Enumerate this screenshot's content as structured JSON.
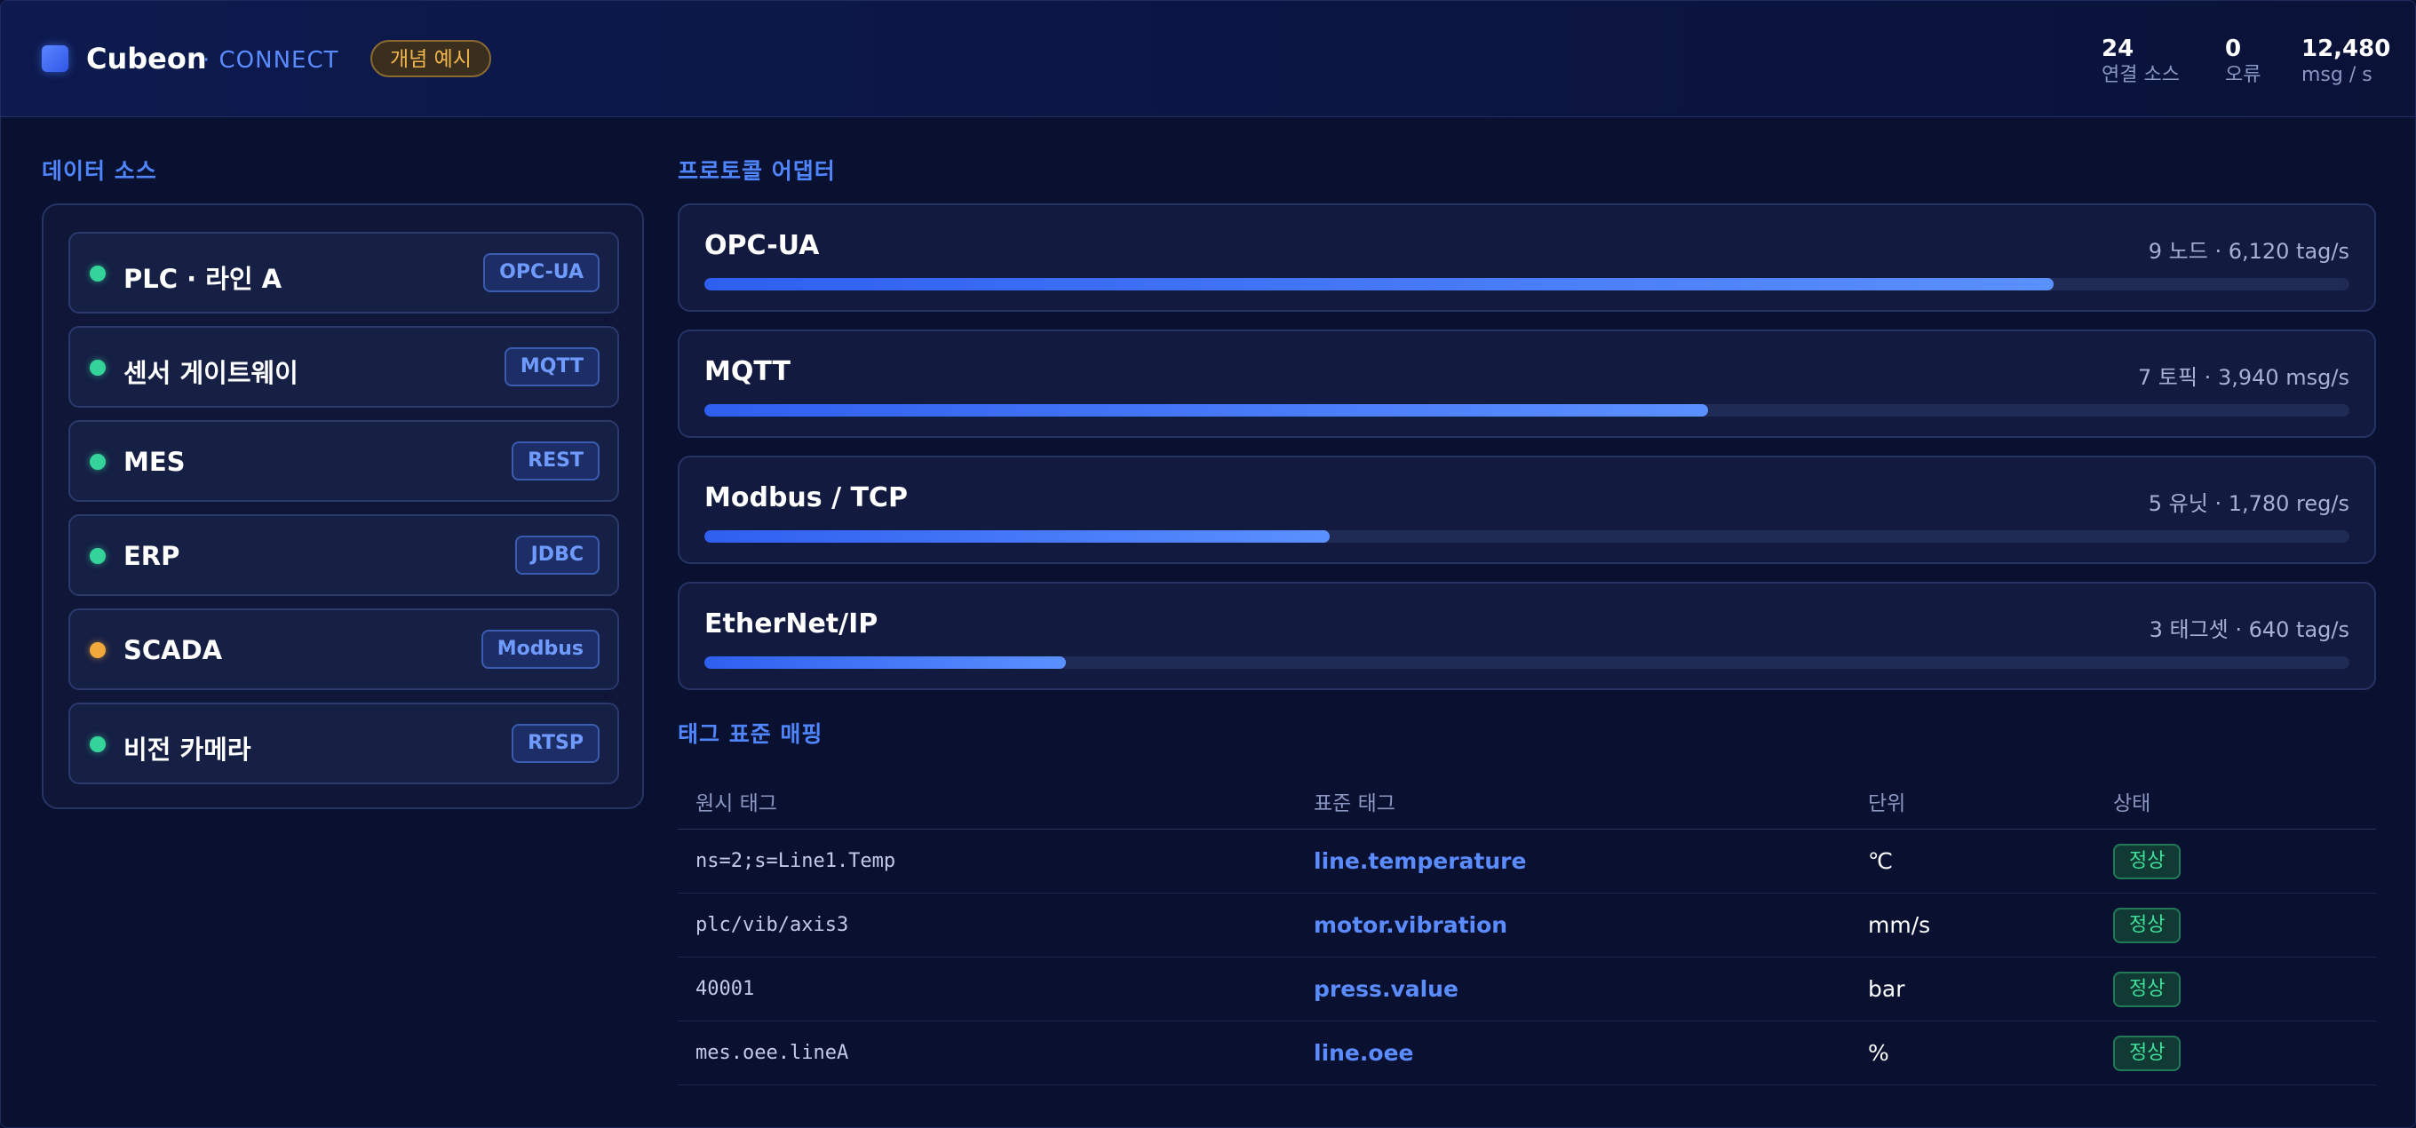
{
  "header": {
    "brand": "Cubeon",
    "brand_sub": "· CONNECT",
    "badge": "개념 예시",
    "stats": [
      {
        "value": "24",
        "label": "연결 소스"
      },
      {
        "value": "0",
        "label": "오류"
      },
      {
        "value": "12,480",
        "label": "msg / s"
      }
    ]
  },
  "sources": {
    "title": "데이터 소스",
    "items": [
      {
        "name": "PLC · 라인 A",
        "protocol": "OPC-UA",
        "status": "green"
      },
      {
        "name": "센서 게이트웨이",
        "protocol": "MQTT",
        "status": "green"
      },
      {
        "name": "MES",
        "protocol": "REST",
        "status": "green"
      },
      {
        "name": "ERP",
        "protocol": "JDBC",
        "status": "green"
      },
      {
        "name": "SCADA",
        "protocol": "Modbus",
        "status": "amber"
      },
      {
        "name": "비전 카메라",
        "protocol": "RTSP",
        "status": "green"
      }
    ]
  },
  "adapters": {
    "title": "프로토콜 어댑터",
    "items": [
      {
        "name": "OPC-UA",
        "meta": "9 노드 · 6,120 tag/s",
        "load": 0.82
      },
      {
        "name": "MQTT",
        "meta": "7 토픽 · 3,940 msg/s",
        "load": 0.61
      },
      {
        "name": "Modbus / TCP",
        "meta": "5 유닛 · 1,780 reg/s",
        "load": 0.38
      },
      {
        "name": "EtherNet/IP",
        "meta": "3 태그셋 · 640 tag/s",
        "load": 0.22
      }
    ]
  },
  "mapping": {
    "title": "태그 표준 매핑",
    "columns": [
      "원시 태그",
      "표준 태그",
      "단위",
      "상태"
    ],
    "rows": [
      {
        "raw": "ns=2;s=Line1.Temp",
        "standard": "line.temperature",
        "unit": "℃",
        "status": "정상"
      },
      {
        "raw": "plc/vib/axis3",
        "standard": "motor.vibration",
        "unit": "mm/s",
        "status": "정상"
      },
      {
        "raw": "40001",
        "standard": "press.value",
        "unit": "bar",
        "status": "정상"
      },
      {
        "raw": "mes.oee.lineA",
        "standard": "line.oee",
        "unit": "%",
        "status": "정상"
      }
    ]
  },
  "colors": {
    "accent": "#4f86ff",
    "ok": "#34d399",
    "warn": "#f2a93b",
    "background": "#0a1030"
  }
}
